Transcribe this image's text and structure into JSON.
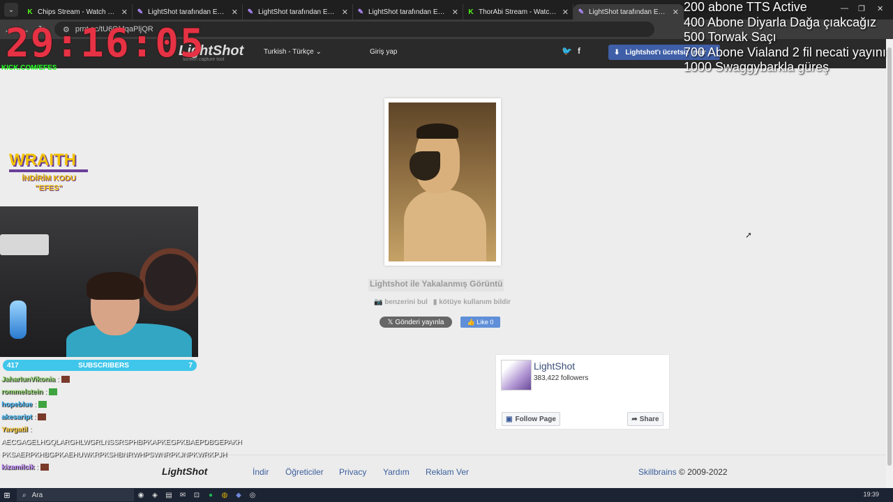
{
  "browser": {
    "tabs": [
      {
        "title": "Chips Stream - Watch Live on K",
        "icon": "kick-icon",
        "active": false
      },
      {
        "title": "LightShot tarafından Ekran Gör",
        "icon": "lightshot-feather-icon",
        "active": false
      },
      {
        "title": "LightShot tarafından Ekran Gör",
        "icon": "lightshot-feather-icon",
        "active": false
      },
      {
        "title": "LightShot tarafından Ekran Gör",
        "icon": "lightshot-feather-icon",
        "active": false
      },
      {
        "title": "ThorAbi Stream - Watch Live o",
        "icon": "kick-icon",
        "active": false
      },
      {
        "title": "LightShot tarafından Ekran Gör",
        "icon": "lightshot-feather-icon",
        "active": true
      }
    ],
    "url": "prnt.sc/tU6OMqaPljQR"
  },
  "site": {
    "logo": "LightShot",
    "logo_sub": "screen capture tool",
    "language": "Turkish - Türkçe",
    "login": "Giriş yap",
    "download_button": "Lightshot'ı ücretsiz indir"
  },
  "screenshot": {
    "caption": "Lightshot ile Yakalanmış Görüntü",
    "find_similar": "benzerini bul",
    "report_abuse": "kötüye kullanım bildir",
    "post_button": "Gönderi yayınla",
    "like_button": "Like 0"
  },
  "facebook": {
    "page_name": "LightShot",
    "followers": "383,422 followers",
    "follow_button": "Follow Page",
    "share_button": "Share"
  },
  "footer": {
    "logo": "LightShot",
    "links": [
      "İndir",
      "Öğreticiler",
      "Privacy",
      "Yardım",
      "Reklam Ver"
    ],
    "copyright_link": "Skillbrains",
    "copyright_text": "© 2009-2022"
  },
  "overlay": {
    "timer": "29:16:05",
    "timer_sub": "KICK.COM/EFES",
    "goals": [
      "200 abone TTS Active",
      "400 Abone Diyarla Dağa çıakcağız",
      "500 Torwak Saçı",
      "700 Abone Vialand 2 fil necati yayını",
      "1000 Swaggybarkla güreş"
    ],
    "wraith_title": "WRAITH",
    "wraith_sub1": "İNDİRİM KODU",
    "wraith_sub2": "\"EFES\"",
    "subscribers_left": "417",
    "subscribers_label": "SUBSCRIBERS",
    "subscribers_right": "7",
    "chat": [
      {
        "user": "JaharIunVikonia",
        "text": ":",
        "class": "u1",
        "emote": "r"
      },
      {
        "user": "rommelstein",
        "text": ":",
        "class": "u1",
        "emote": "g"
      },
      {
        "user": "hopeblue",
        "text": ":",
        "class": "u2",
        "emote": "g"
      },
      {
        "user": "akesaript",
        "text": ":",
        "class": "u2",
        "emote": "r"
      },
      {
        "user": "Yavgatil",
        "text": ":",
        "class": "u3",
        "emote": ""
      },
      {
        "user": "",
        "text": "AECGAGELHGQLARGHLWGRLNSSRSPHBPKAPKEGPKBAEPDBGEPAKHB",
        "class": "u4",
        "emote": ""
      },
      {
        "user": "",
        "text": "PKSAERPKHBGPKAEHUWKRPKSHBNRWHPSWNRPKJNPKWRKPJH",
        "class": "u4",
        "emote": ""
      },
      {
        "user": "kizamilcik",
        "text": ":",
        "class": "u4",
        "emote": "r"
      }
    ]
  },
  "taskbar": {
    "search_placeholder": "Ara",
    "clock": "19:39"
  }
}
